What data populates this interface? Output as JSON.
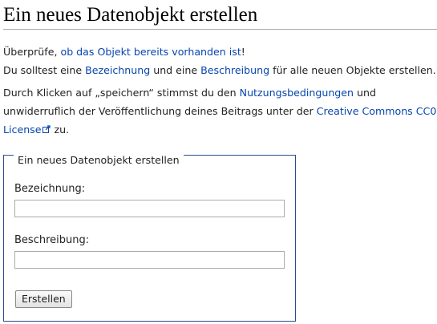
{
  "page_title": "Ein neues Datenobjekt erstellen",
  "intro": {
    "line1_pre": "Überprüfe, ",
    "line1_link": "ob das Objekt bereits vorhanden ist",
    "line1_post": "!",
    "line2_pre": "Du solltest eine ",
    "line2_link1": "Bezeichnung",
    "line2_mid": " und eine ",
    "line2_link2": "Beschreibung",
    "line2_post": " für alle neuen Objekte erstellen."
  },
  "terms": {
    "pre": "Durch Klicken auf „speichern“ stimmst du den ",
    "link1": "Nutzungsbedingungen",
    "mid": " und unwiderruflich der Veröffentlichung deines Beitrags unter der ",
    "link2": "Creative Commons CC0 License",
    "post": " zu."
  },
  "form": {
    "legend": "Ein neues Datenobjekt erstellen",
    "label_label": "Bezeichnung:",
    "label_value": "",
    "description_label": "Beschreibung:",
    "description_value": "",
    "submit_label": "Erstellen"
  },
  "icons": {
    "external_link": "external-link-icon"
  },
  "colors": {
    "link": "#0645ad",
    "fieldset_border": "#2a4b8d",
    "rule": "#aaaaaa"
  }
}
